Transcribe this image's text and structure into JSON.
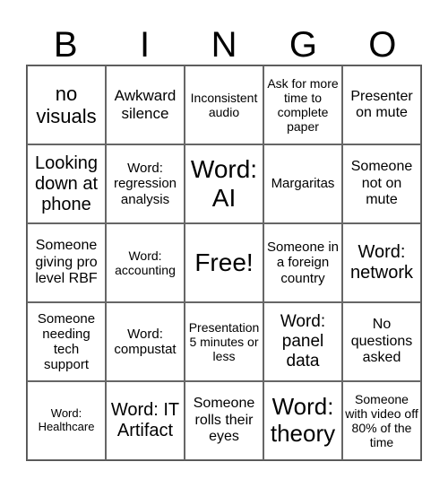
{
  "header": {
    "letters": [
      "B",
      "I",
      "N",
      "G",
      "O"
    ]
  },
  "cells": [
    "no visuals",
    "Awkward silence",
    "Inconsistent audio",
    "Ask for more time to complete paper",
    "Presenter on mute",
    "Looking down at phone",
    "Word: regression analysis",
    "Word: AI",
    "Margaritas",
    "Someone not on mute",
    "Someone giving pro level RBF",
    "Word: accounting",
    "Free!",
    "Someone in a foreign country",
    "Word: network",
    "Someone needing tech support",
    "Word: compustat",
    "Presentation 5 minutes or less",
    "Word: panel data",
    "No questions asked",
    "Word: Healthcare",
    "Word: IT Artifact",
    "Someone rolls their eyes",
    "Word: theory",
    "Someone with video off 80% of the time"
  ]
}
